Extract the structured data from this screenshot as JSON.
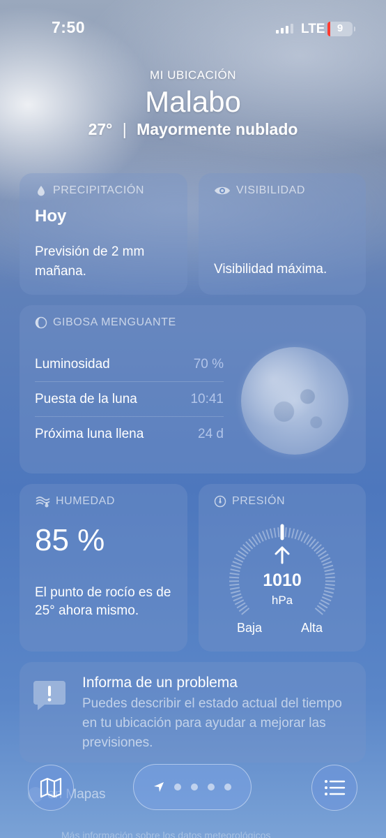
{
  "status_bar": {
    "time": "7:50",
    "network": "LTE",
    "battery": "9"
  },
  "header": {
    "location_label": "MI UBICACIÓN",
    "city": "Malabo",
    "temperature": "27°",
    "separator": "|",
    "condition": "Mayormente nublado"
  },
  "precipitation": {
    "title": "PRECIPITACIÓN",
    "headline": "Hoy",
    "description": "Previsión de 2 mm mañana."
  },
  "visibility": {
    "title": "VISIBILIDAD",
    "description": "Visibilidad máxima."
  },
  "moon": {
    "title": "GIBOSA MENGUANTE",
    "rows": [
      {
        "label": "Luminosidad",
        "value": "70 %"
      },
      {
        "label": "Puesta de la luna",
        "value": "10:41"
      },
      {
        "label": "Próxima luna llena",
        "value": "24 d"
      }
    ]
  },
  "humidity": {
    "title": "HUMEDAD",
    "value": "85 %",
    "description": "El punto de rocío es de 25° ahora mismo."
  },
  "pressure": {
    "title": "PRESIÓN",
    "value": "1010",
    "unit": "hPa",
    "low_label": "Baja",
    "high_label": "Alta",
    "trend": "rising"
  },
  "report": {
    "title": "Informa de un problema",
    "description": "Puedes describir el estado actual del tiempo en tu ubicación para ayudar a mejorar las previsiones."
  },
  "maps_link": {
    "label": "en Mapas"
  },
  "footer_note": {
    "text": "Más información sobre los datos meteorológicos"
  },
  "colors": {
    "alert_red": "#ff3b30",
    "card_bg": "rgba(120,150,200,0.35)"
  }
}
